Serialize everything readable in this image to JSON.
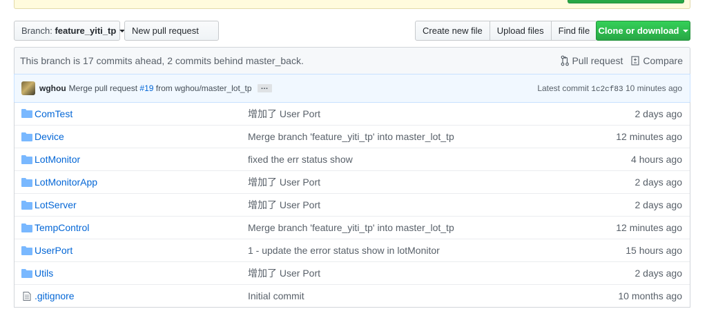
{
  "toolbar": {
    "branch_prefix": "Branch:",
    "branch_name": "feature_yiti_tp",
    "new_pull_request": "New pull request",
    "create_new_file": "Create new file",
    "upload_files": "Upload files",
    "find_file": "Find file",
    "clone_or_download": "Clone or download"
  },
  "branch_status": {
    "text": "This branch is 17 commits ahead, 2 commits behind master_back.",
    "pull_request": "Pull request",
    "compare": "Compare"
  },
  "latest_commit": {
    "author": "wghou",
    "message_prefix": "Merge pull request",
    "pr_number": "#19",
    "message_suffix": "from wghou/master_lot_tp",
    "ellipsis": "…",
    "label": "Latest commit",
    "sha": "1c2cf83",
    "age": "10 minutes ago"
  },
  "files": [
    {
      "type": "dir",
      "name": "ComTest",
      "message": "增加了 User Port",
      "age": "2 days ago"
    },
    {
      "type": "dir",
      "name": "Device",
      "message": "Merge branch 'feature_yiti_tp' into master_lot_tp",
      "age": "12 minutes ago"
    },
    {
      "type": "dir",
      "name": "LotMonitor",
      "message": "fixed the err status show",
      "age": "4 hours ago"
    },
    {
      "type": "dir",
      "name": "LotMonitorApp",
      "message": "增加了 User Port",
      "age": "2 days ago"
    },
    {
      "type": "dir",
      "name": "LotServer",
      "message": "增加了 User Port",
      "age": "2 days ago"
    },
    {
      "type": "dir",
      "name": "TempControl",
      "message": "Merge branch 'feature_yiti_tp' into master_lot_tp",
      "age": "12 minutes ago"
    },
    {
      "type": "dir",
      "name": "UserPort",
      "message": "1 - update the error status show in lotMonitor",
      "age": "15 hours ago"
    },
    {
      "type": "dir",
      "name": "Utils",
      "message": "增加了 User Port",
      "age": "2 days ago"
    },
    {
      "type": "file",
      "name": ".gitignore",
      "message": "Initial commit",
      "age": "10 months ago"
    }
  ],
  "icons": {
    "dir": "folder-icon",
    "file": "file-icon",
    "pull_request": "git-pull-request-icon",
    "compare": "diff-icon"
  },
  "colors": {
    "link": "#0366d6",
    "muted": "#586069",
    "green": "#28a745",
    "folder": "#79b8ff"
  }
}
